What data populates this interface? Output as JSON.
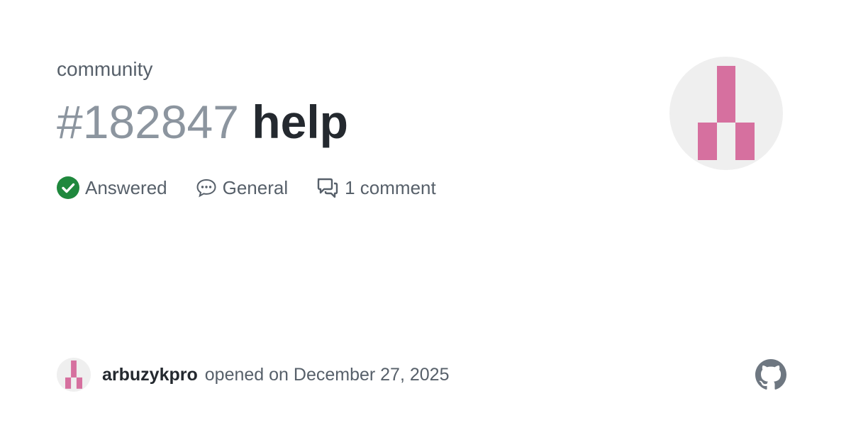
{
  "repo": {
    "name": "community"
  },
  "issue": {
    "number": "#182847",
    "title": "help"
  },
  "meta": {
    "status": {
      "label": "Answered",
      "icon": "check-circle-icon",
      "color": "#1f883d"
    },
    "category": {
      "label": "General",
      "icon": "speech-balloon-icon"
    },
    "comments": {
      "label": "1 comment",
      "icon": "comment-discussion-icon"
    }
  },
  "author": {
    "username": "arbuzykpro",
    "opened_text": "opened on December 27, 2025",
    "avatar_color": "#d6709f"
  },
  "brand": {
    "logo": "github-icon",
    "color": "#6e7781"
  }
}
